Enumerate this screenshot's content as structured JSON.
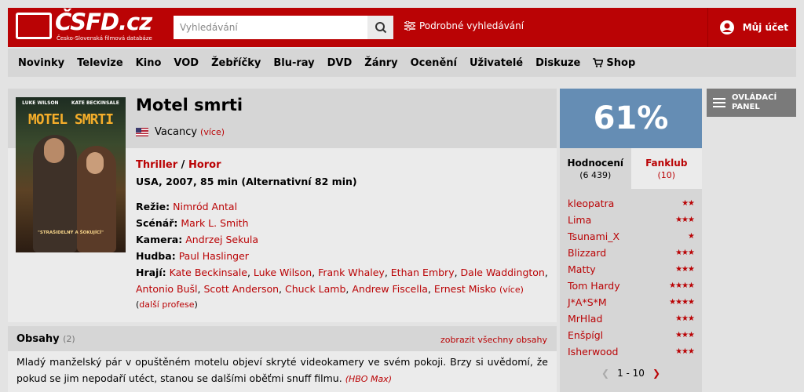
{
  "header": {
    "logo_text": "ČSFD.cz",
    "logo_sub": "Česko-Slovenská filmová databáze",
    "search_placeholder": "Vyhledávání",
    "advanced_search": "Podrobné vyhledávání",
    "account": "Můj účet"
  },
  "nav": [
    "Novinky",
    "Televize",
    "Kino",
    "VOD",
    "Žebříčky",
    "Blu-ray",
    "DVD",
    "Žánry",
    "Ocenění",
    "Uživatelé",
    "Diskuze",
    "Shop"
  ],
  "film": {
    "title": "Motel smrti",
    "original_title": "Vacancy",
    "more": "(více)",
    "genre1": "Thriller",
    "genre_sep": " / ",
    "genre2": "Horor",
    "origin": "USA, 2007, 85 min (Alternativní 82 min)",
    "poster": {
      "actor1": "LUKE WILSON",
      "actor2": "KATE BECKINSALE",
      "title": "MOTEL SMRTI",
      "quote": "\"STRAŠIDELNÝ A ŠOKUJÍCÍ\""
    },
    "creators": {
      "rezie_label": "Režie:",
      "rezie": "Nimród Antal",
      "scenar_label": "Scénář:",
      "scenar": "Mark L. Smith",
      "kamera_label": "Kamera:",
      "kamera": "Andrzej Sekula",
      "hudba_label": "Hudba:",
      "hudba": "Paul Haslinger",
      "hraji_label": "Hrají:",
      "actors": [
        "Kate Beckinsale",
        "Luke Wilson",
        "Frank Whaley",
        "Ethan Embry",
        "Dale Waddington",
        "Antonio Bušl",
        "Scott Anderson",
        "Chuck Lamb",
        "Andrew Fiscella",
        "Ernest Misko"
      ],
      "more": "(více)",
      "more_professions": "(další profese)"
    }
  },
  "plot": {
    "title": "Obsahy",
    "count": "(2)",
    "show_all": "zobrazit všechny obsahy",
    "text": "Mladý manželský pár v opuštěném motelu objeví skryté videokamery ve svém pokoji. Brzy si uvědomí, že pokud se jim nepodaří utéct, stanou se dalšími oběťmi snuff filmu.",
    "source": "(HBO Max)"
  },
  "rating": {
    "percent": "61%",
    "tab_ratings": "Hodnocení",
    "tab_ratings_count": "(6 439)",
    "tab_fanclub": "Fanklub",
    "tab_fanclub_count": "(10)",
    "users": [
      {
        "name": "kleopatra",
        "stars": 2
      },
      {
        "name": "Lima",
        "stars": 3
      },
      {
        "name": "Tsunami_X",
        "stars": 1
      },
      {
        "name": "Blizzard",
        "stars": 3
      },
      {
        "name": "Matty",
        "stars": 3
      },
      {
        "name": "Tom Hardy",
        "stars": 4
      },
      {
        "name": "J*A*S*M",
        "stars": 4
      },
      {
        "name": "MrHlad",
        "stars": 3
      },
      {
        "name": "Enšpígl",
        "stars": 3
      },
      {
        "name": "Isherwood",
        "stars": 3
      }
    ],
    "pager": "1 - 10"
  },
  "panel": {
    "label_line1": "OVLÁDACÍ",
    "label_line2": "PANEL"
  }
}
